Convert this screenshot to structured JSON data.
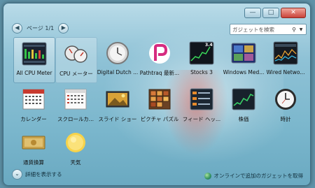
{
  "window": {
    "caption_buttons": [
      {
        "name": "minimize-button",
        "glyph": "—"
      },
      {
        "name": "maximize-button",
        "glyph": "□"
      },
      {
        "name": "close-button",
        "glyph": "✕"
      }
    ]
  },
  "pager": {
    "label": "ページ 1/1",
    "prev_icon": "◀",
    "next_icon": "▶"
  },
  "search": {
    "placeholder": "ガジェットを検索",
    "icon": "⚲",
    "dropdown_icon": "▼"
  },
  "gadgets": [
    {
      "label": "All CPU Meter",
      "icon": "cpu-meter-icon",
      "state": "selected"
    },
    {
      "label": "CPU メーター",
      "icon": "dual-gauge-icon",
      "state": "hover"
    },
    {
      "label": "Digital Dutch ...",
      "icon": "round-clock-icon",
      "state": ""
    },
    {
      "label": "Pathtraq 最新...",
      "icon": "pathtraq-logo-icon",
      "state": ""
    },
    {
      "label": "Stocks 3",
      "icon": "stocks-chart-icon",
      "state": "",
      "badge": "3.4"
    },
    {
      "label": "Windows Med...",
      "icon": "media-center-icon",
      "state": ""
    },
    {
      "label": "Wired Netwo...",
      "icon": "network-monitor-icon",
      "state": ""
    },
    {
      "label": "カレンダー",
      "icon": "calendar-icon",
      "state": ""
    },
    {
      "label": "スクロールカ...",
      "icon": "scroll-calendar-icon",
      "state": ""
    },
    {
      "label": "スライド ショー",
      "icon": "slideshow-icon",
      "state": ""
    },
    {
      "label": "ピクチャ パズル",
      "icon": "picture-puzzle-icon",
      "state": ""
    },
    {
      "label": "フィード ヘッ...",
      "icon": "feed-headlines-icon",
      "state": ""
    },
    {
      "label": "株価",
      "icon": "stock-graph-icon",
      "state": ""
    },
    {
      "label": "時計",
      "icon": "clock-icon",
      "state": ""
    },
    {
      "label": "通貨換算",
      "icon": "currency-icon",
      "state": ""
    },
    {
      "label": "天気",
      "icon": "weather-sun-icon",
      "state": ""
    }
  ],
  "footer": {
    "details_label": "詳細を表示する",
    "details_icon": "⌄",
    "online_label": "オンラインで追加のガジェットを取得"
  },
  "colors": {
    "accent": "#7ab6cc",
    "selection": "#dbeef6"
  }
}
